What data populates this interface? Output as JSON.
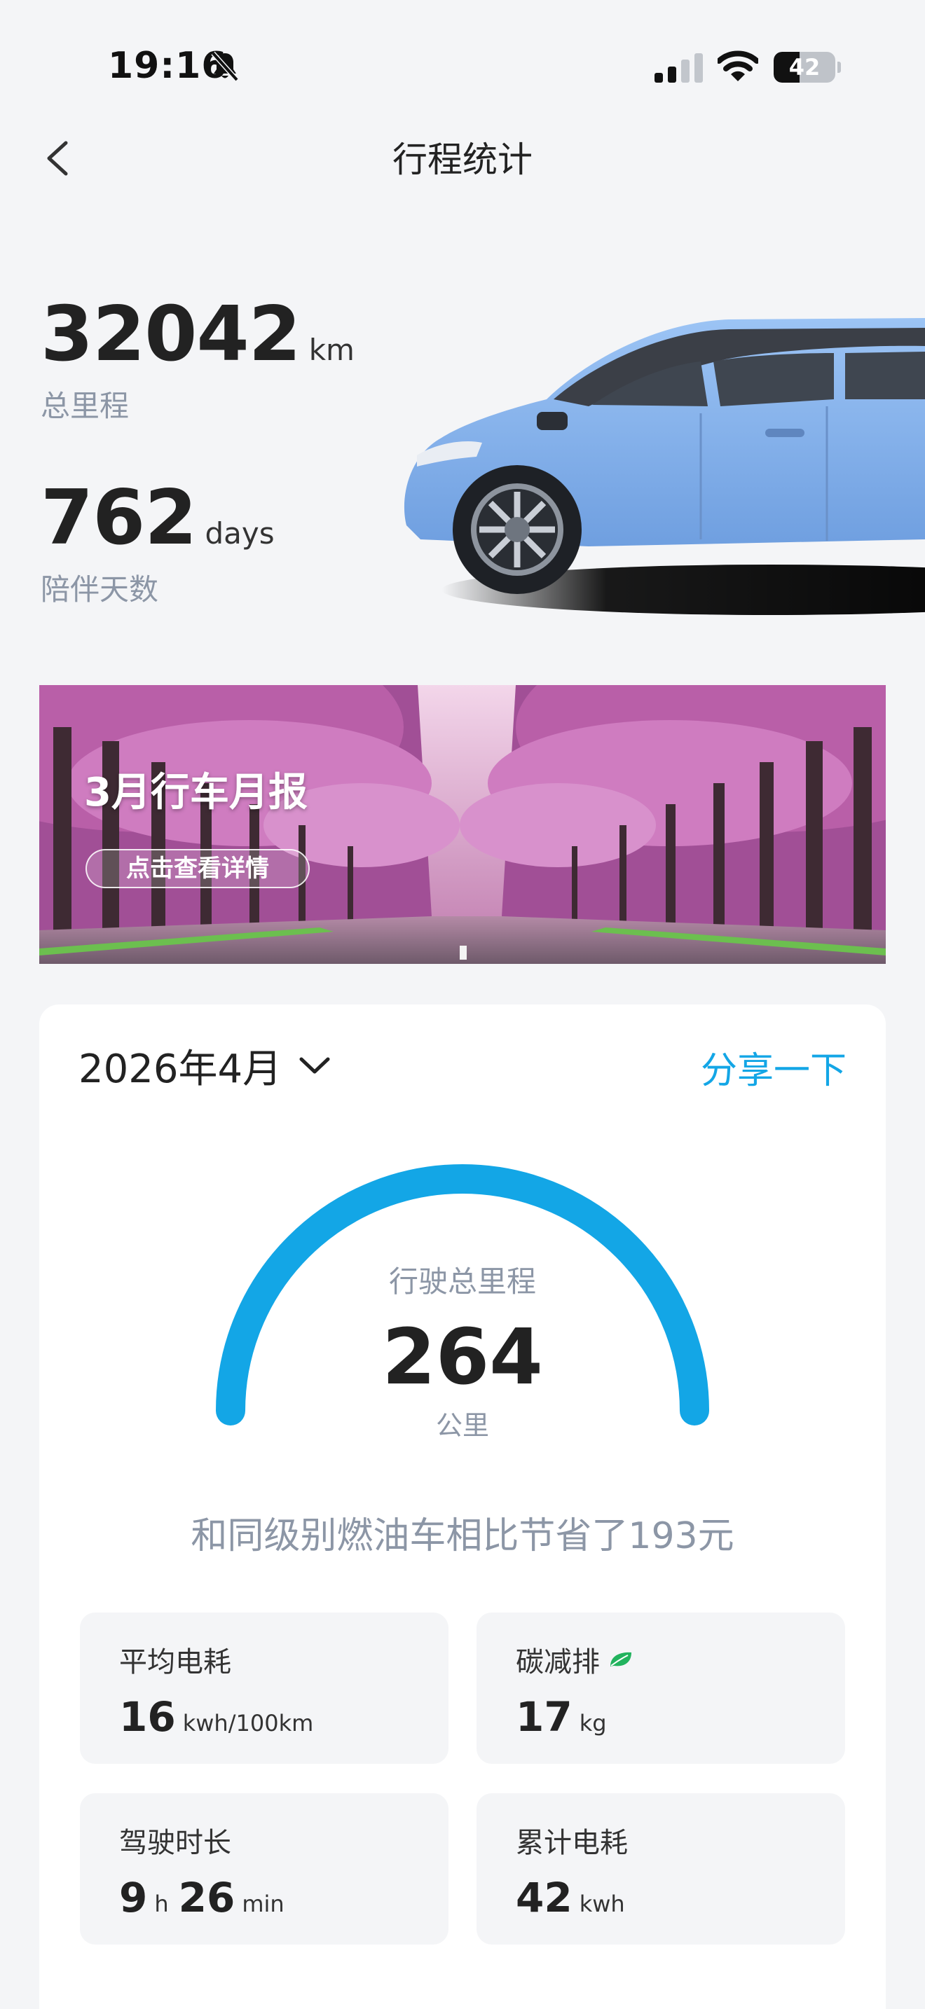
{
  "status_bar": {
    "time": "19:16",
    "battery": "42",
    "battery_level": 0.42
  },
  "nav": {
    "title": "行程统计"
  },
  "stats": {
    "total_mileage": {
      "value": "32042",
      "unit": "km",
      "label": "总里程"
    },
    "days": {
      "value": "762",
      "unit": "days",
      "label": "陪伴天数"
    }
  },
  "banner": {
    "title": "3月行车月报",
    "button": "点击查看详情"
  },
  "card": {
    "month": "2026年4月",
    "share": "分享一下",
    "gauge": {
      "label": "行驶总里程",
      "value": "264",
      "unit": "公里"
    },
    "saving": "和同级别燃油车相比节省了193元",
    "metrics": {
      "avg_consumption": {
        "label": "平均电耗",
        "value": "16",
        "unit": "kwh/100km"
      },
      "carbon": {
        "label": "碳减排",
        "value": "17",
        "unit": "kg"
      },
      "duration": {
        "label": "驾驶时长",
        "hours": "9",
        "hours_unit": "h",
        "minutes": "26",
        "minutes_unit": "min"
      },
      "total_consumption": {
        "label": "累计电耗",
        "value": "42",
        "unit": "kwh"
      }
    }
  },
  "colors": {
    "accent": "#13a6e6",
    "leaf": "#22b35e",
    "car": "#7fb0ef"
  },
  "icons": [
    "bell-slash-icon",
    "cellular-signal-icon",
    "wifi-icon",
    "battery-icon",
    "chevron-left-icon",
    "chevron-down-icon",
    "leaf-icon"
  ]
}
